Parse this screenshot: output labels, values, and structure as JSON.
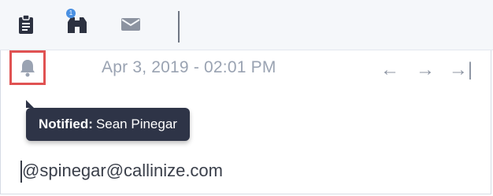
{
  "toolbar": {
    "icons": [
      "clipboard-icon",
      "binoculars-icon",
      "mail-icon"
    ],
    "badge": "1"
  },
  "meta": {
    "timestamp": "Apr 3, 2019 - 02:01 PM",
    "nav": {
      "prev": "←",
      "next": "→",
      "last": "→|"
    }
  },
  "tooltip": {
    "label": "Notified:",
    "value": "Sean Pinegar"
  },
  "editor": {
    "text": "@spinegar@callinize.com"
  },
  "colors": {
    "highlight": "#e05252",
    "tooltip_bg": "#2e3447",
    "icon": "#2c3140",
    "muted": "#9aa3b2"
  }
}
